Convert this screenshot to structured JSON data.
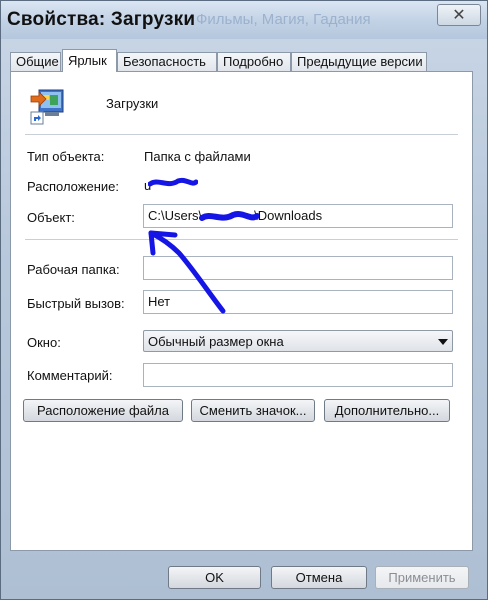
{
  "window": {
    "title": "Свойства: Загрузки",
    "background_title": "Фильмы, Магия, Гадания"
  },
  "tabs": [
    {
      "label": "Общие",
      "active": false
    },
    {
      "label": "Ярлык",
      "active": true
    },
    {
      "label": "Безопасность",
      "active": false
    },
    {
      "label": "Подробно",
      "active": false
    },
    {
      "label": "Предыдущие версии",
      "active": false
    }
  ],
  "shortcut": {
    "icon": "shortcut-folder-icon",
    "name": "Загрузки"
  },
  "fields": {
    "type_label": "Тип объекта:",
    "type_value": "Папка с файлами",
    "location_label": "Расположение:",
    "location_value": "u",
    "target_label": "Объект:",
    "target_prefix": "C:\\Users\\",
    "target_suffix": "\\Downloads",
    "workdir_label": "Рабочая папка:",
    "workdir_value": "",
    "hotkey_label": "Быстрый вызов:",
    "hotkey_value": "Нет",
    "window_label": "Окно:",
    "window_value": "Обычный размер окна",
    "comment_label": "Комментарий:",
    "comment_value": ""
  },
  "buttons": {
    "open_location": "Расположение файла",
    "change_icon": "Сменить значок...",
    "advanced": "Дополнительно...",
    "ok": "OK",
    "cancel": "Отмена",
    "apply": "Применить"
  },
  "colors": {
    "annotation": "#1515e6"
  }
}
